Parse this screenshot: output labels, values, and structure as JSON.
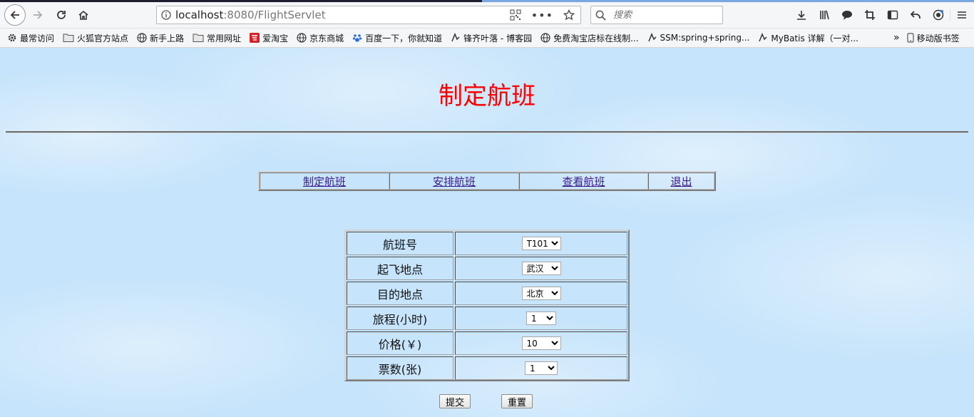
{
  "browser": {
    "url_host": "localhost",
    "url_rest": ":8080/FlightServlet",
    "search_placeholder": "搜索",
    "bookmarks": [
      "最常访问",
      "火狐官方站点",
      "新手上路",
      "常用网址",
      "爱淘宝",
      "京东商城",
      "百度一下，你就知道",
      "锋齐叶落 - 博客园",
      "免费淘宝店标在线制...",
      "SSM:spring+spring...",
      "MyBatis 详解（一对..."
    ],
    "mobile_bookmarks": "移动版书签"
  },
  "page": {
    "title": "制定航班",
    "menu": [
      "制定航班",
      "安排航班",
      "查看航班",
      "退出"
    ],
    "form": {
      "rows": [
        {
          "label": "航班号",
          "value": "T101"
        },
        {
          "label": "起飞地点",
          "value": "武汉"
        },
        {
          "label": "目的地点",
          "value": "北京"
        },
        {
          "label": "旅程(小时)",
          "value": "1"
        },
        {
          "label": "价格(￥)",
          "value": "10"
        },
        {
          "label": "票数(张)",
          "value": "1"
        }
      ]
    },
    "submit_label": "提交",
    "reset_label": "重置"
  }
}
